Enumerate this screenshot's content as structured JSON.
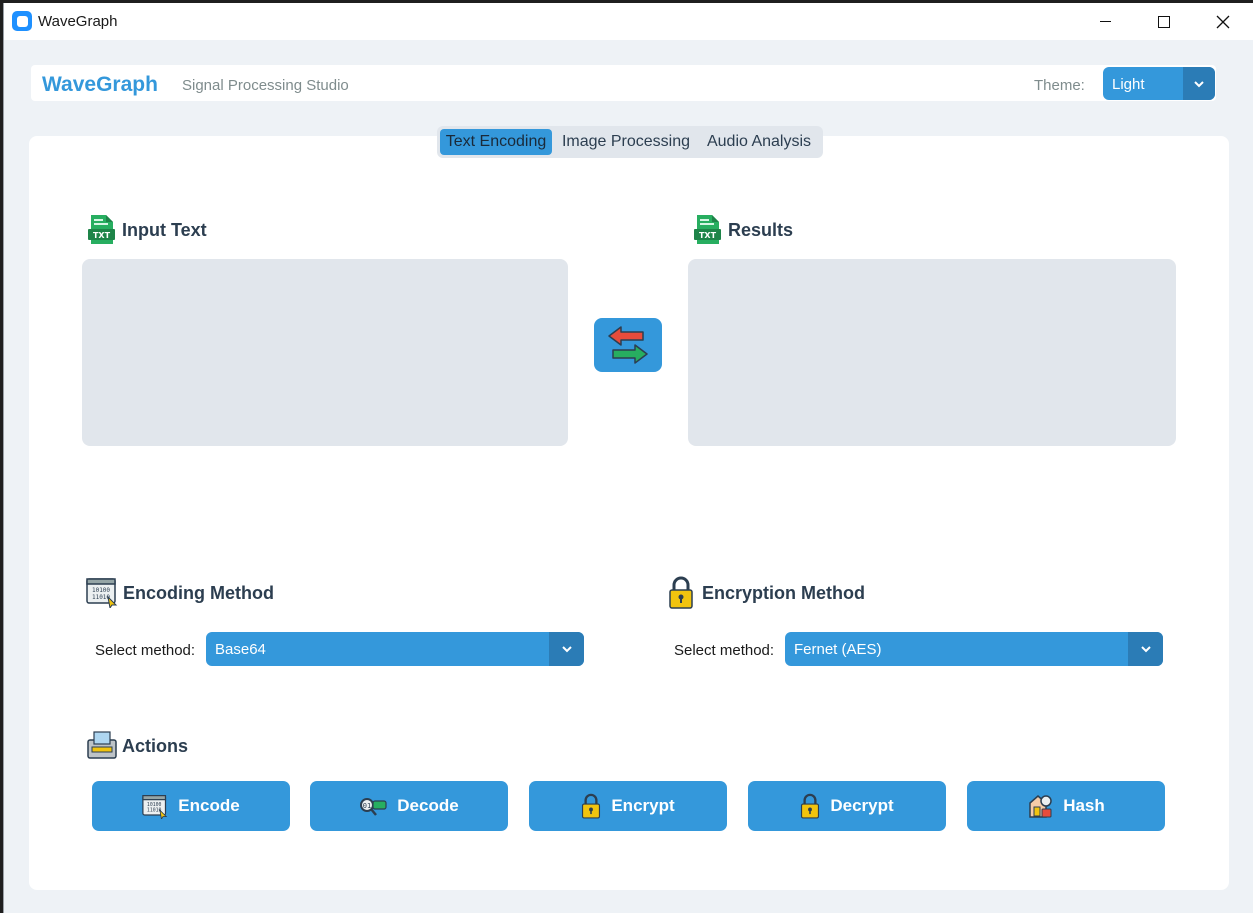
{
  "window": {
    "title": "WaveGraph"
  },
  "header": {
    "brand": "WaveGraph",
    "subtitle": "Signal Processing Studio",
    "theme_label": "Theme:",
    "theme_value": "Light"
  },
  "tabs": [
    {
      "label": "Text Encoding",
      "active": true
    },
    {
      "label": "Image Processing",
      "active": false
    },
    {
      "label": "Audio Analysis",
      "active": false
    }
  ],
  "input": {
    "title": "Input Text",
    "value": ""
  },
  "results": {
    "title": "Results",
    "value": ""
  },
  "encoding": {
    "title": "Encoding Method",
    "select_label": "Select method:",
    "selected": "Base64"
  },
  "encryption": {
    "title": "Encryption Method",
    "select_label": "Select method:",
    "selected": "Fernet (AES)"
  },
  "actions": {
    "title": "Actions",
    "buttons": [
      {
        "label": "Encode",
        "icon": "binary-code-icon"
      },
      {
        "label": "Decode",
        "icon": "key-decode-icon"
      },
      {
        "label": "Encrypt",
        "icon": "lock-icon"
      },
      {
        "label": "Decrypt",
        "icon": "lock-icon"
      },
      {
        "label": "Hash",
        "icon": "hash-icon"
      }
    ]
  },
  "colors": {
    "accent": "#3498db",
    "accent_dark": "#2b7cb6",
    "background": "#eef2f6",
    "text": "#2c3e50",
    "muted": "#7f8c8d"
  }
}
